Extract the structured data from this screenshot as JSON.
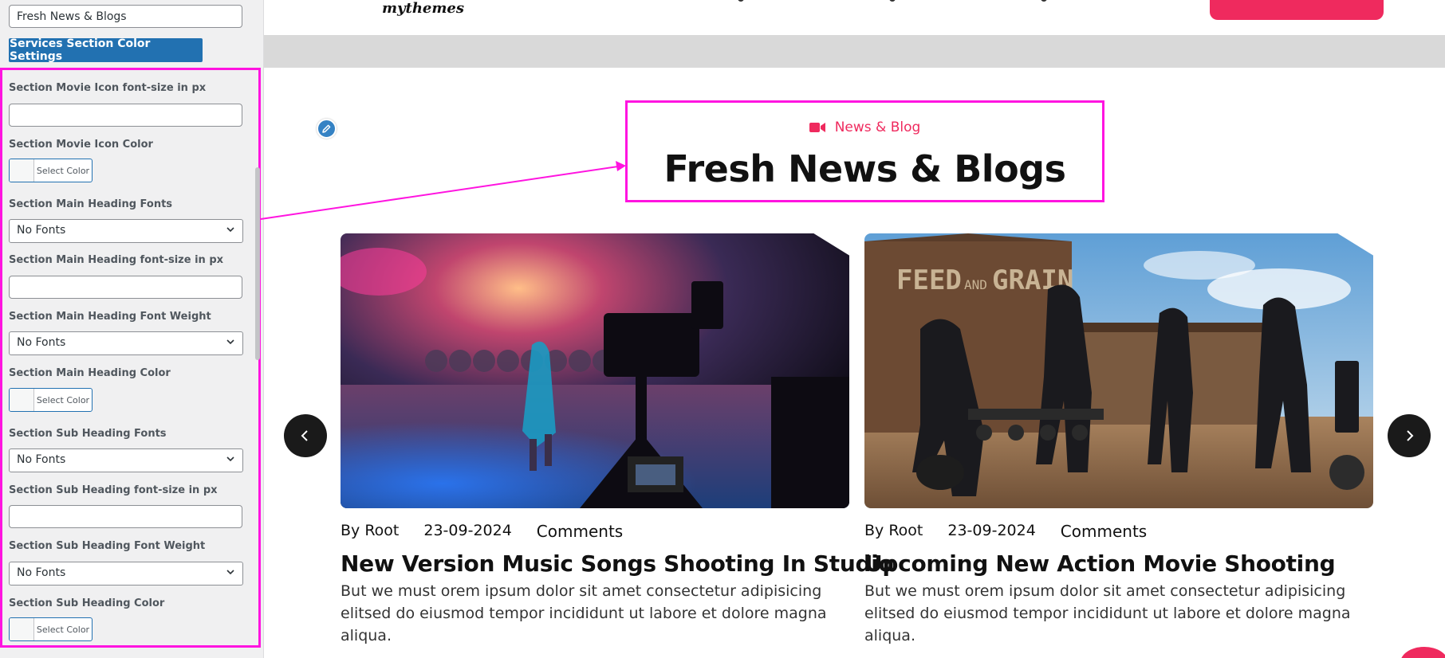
{
  "panel": {
    "heading_input_value": "Fresh News & Blogs",
    "color_settings_button": "Services Section Color Settings",
    "fields": {
      "movie_icon_size_label": "Section Movie Icon font-size in px",
      "movie_icon_color_label": "Section Movie Icon Color",
      "main_heading_fonts_label": "Section Main Heading Fonts",
      "main_heading_fonts_value": "No Fonts",
      "main_heading_size_label": "Section Main Heading font-size in px",
      "main_heading_weight_label": "Section Main Heading Font Weight",
      "main_heading_weight_value": "No Fonts",
      "main_heading_color_label": "Section Main Heading Color",
      "sub_heading_fonts_label": "Section Sub Heading Fonts",
      "sub_heading_fonts_value": "No Fonts",
      "sub_heading_size_label": "Section Sub Heading font-size in px",
      "sub_heading_weight_label": "Section Sub Heading Font Weight",
      "sub_heading_weight_value": "No Fonts",
      "sub_heading_color_label": "Section Sub Heading Color"
    },
    "select_color_label": "Select Color"
  },
  "preview": {
    "logo_text": "mythemes",
    "section": {
      "sub_heading": "News & Blog",
      "main_heading": "Fresh News & Blogs"
    },
    "cards": [
      {
        "author": "By Root",
        "date": "23-09-2024",
        "comments": "Comments",
        "title": "New Version Music Songs Shooting In Studio",
        "excerpt": "But we must orem ipsum dolor sit amet consectetur adipisicing elitsed do eiusmod tempor incididunt ut labore et dolore magna aliqua."
      },
      {
        "author": "By Root",
        "date": "23-09-2024",
        "comments": "Comments",
        "title": "Upcoming New Action Movie Shooting",
        "excerpt": "But we must orem ipsum dolor sit amet consectetur adipisicing elitsed do eiusmod tempor incididunt ut labore et dolore magna aliqua."
      }
    ]
  },
  "colors": {
    "accent": "#ef2a5e",
    "highlight": "#ff14e0",
    "wp_blue": "#2271b1"
  },
  "icons": {
    "movie": "video-camera-icon",
    "edit": "pencil-icon",
    "prev": "chevron-left-icon",
    "next": "chevron-right-icon"
  }
}
